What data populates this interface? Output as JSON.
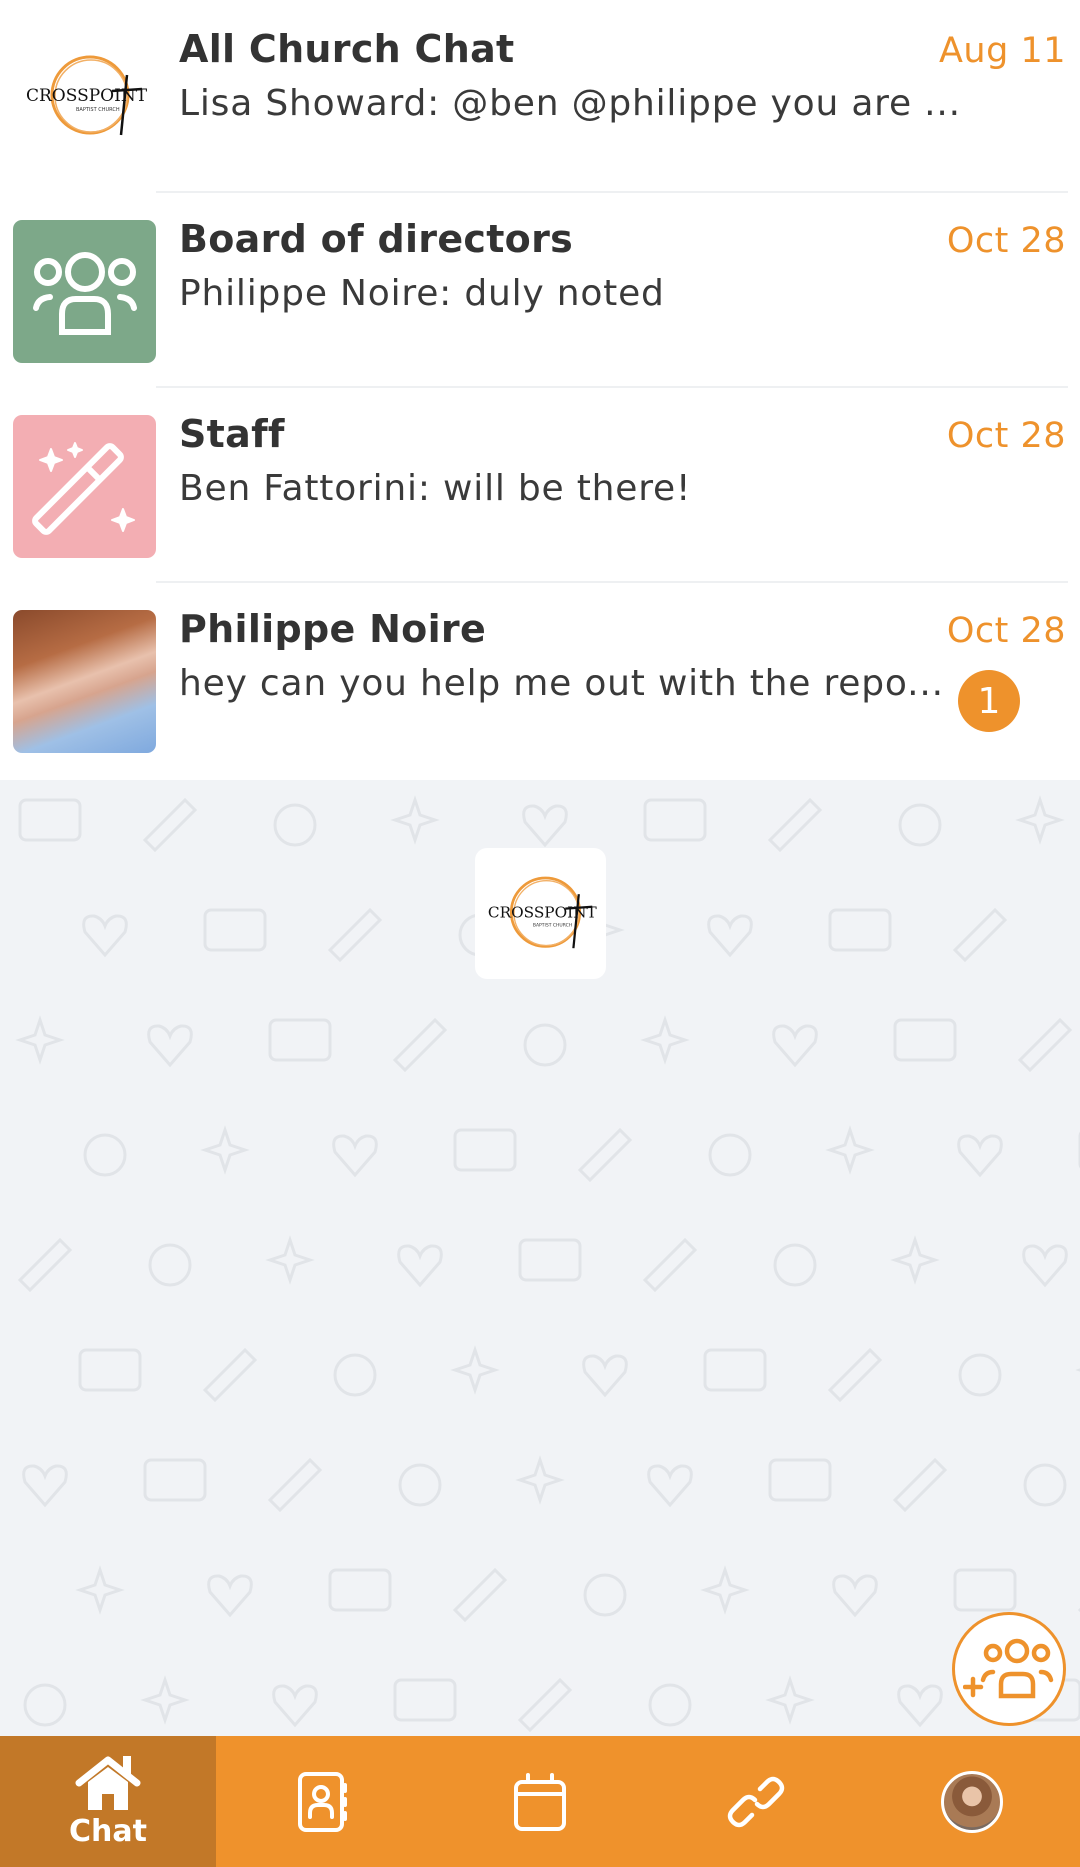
{
  "chats": [
    {
      "title": "All Church Chat",
      "preview": "Lisa Showard: @ben @philippe you are ...",
      "date": "Aug 11",
      "avatar": "crosspoint-logo",
      "unread": null
    },
    {
      "title": "Board of directors",
      "preview": "Philippe Noire: duly noted",
      "date": "Oct 28",
      "avatar": "group-icon",
      "avatar_color": "#7da889",
      "unread": null
    },
    {
      "title": "Staff",
      "preview": "Ben Fattorini: will be there!",
      "date": "Oct 28",
      "avatar": "magic-wand-icon",
      "avatar_color": "#f3aeb3",
      "unread": null
    },
    {
      "title": "Philippe Noire",
      "preview": "hey can you help me out with the repo...",
      "date": "Oct 28",
      "avatar": "user-photo",
      "unread": "1"
    }
  ],
  "logo": {
    "name": "CROSSPOINT",
    "subtitle": "BAPTIST CHURCH"
  },
  "fab": {
    "icon": "add-group-icon"
  },
  "bottom_nav": {
    "items": [
      {
        "label": "Chat",
        "icon": "home-icon",
        "active": true
      },
      {
        "label": "",
        "icon": "contacts-book-icon",
        "active": false
      },
      {
        "label": "",
        "icon": "calendar-icon",
        "active": false
      },
      {
        "label": "",
        "icon": "link-icon",
        "active": false
      },
      {
        "label": "",
        "icon": "profile-avatar",
        "active": false
      }
    ]
  },
  "colors": {
    "accent": "#ee922c",
    "nav_bg": "#ef922c",
    "nav_active": "#c27828",
    "background": "#f1f3f6"
  }
}
